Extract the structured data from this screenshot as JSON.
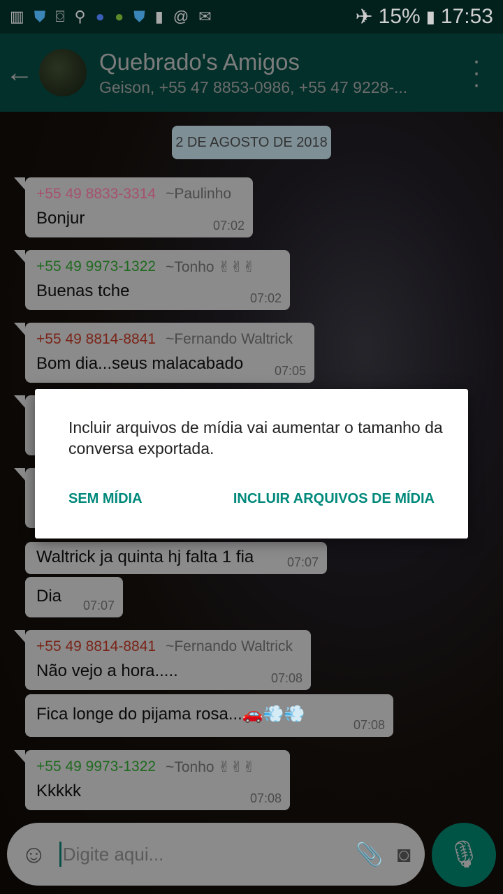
{
  "status_bar": {
    "battery": "15%",
    "time": "17:53"
  },
  "header": {
    "title": "Quebrado's Amigos",
    "subtitle": "Geison, +55 47 8853-0986, +55 47 9228-..."
  },
  "date_label": "2 DE AGOSTO DE 2018",
  "messages": [
    {
      "number": "+55 49 8833-3314",
      "alias": "~Paulinho",
      "text": "Bonjur",
      "time": "07:02"
    },
    {
      "number": "+55 49 9973-1322",
      "alias": "~Tonho ✌✌✌",
      "text": "Buenas tche",
      "time": "07:02"
    },
    {
      "number": "+55 49 8814-8841",
      "alias": "~Fernando Waltrick",
      "text": "Bom dia...seus malacabado",
      "time": "07:05"
    },
    {
      "text": "Waltrick ja quinta hj falta 1 fia",
      "time": "07:07"
    },
    {
      "text": "Dia",
      "time": "07:07"
    },
    {
      "number": "+55 49 8814-8841",
      "alias": "~Fernando Waltrick",
      "text": "Não vejo a hora.....",
      "time": "07:08"
    },
    {
      "text": "Fica longe do pijama rosa...🚗💨💨",
      "time": "07:08"
    },
    {
      "number": "+55 49 9973-1322",
      "alias": "~Tonho ✌✌✌",
      "text": "Kkkkk",
      "time": "07:08"
    }
  ],
  "input": {
    "placeholder": "Digite aqui..."
  },
  "dialog": {
    "message": "Incluir arquivos de mídia vai aumentar o tamanho da conversa exportada.",
    "no_media": "SEM MÍDIA",
    "include_media": "INCLUIR ARQUIVOS DE MÍDIA"
  },
  "colors": {
    "pink": "#e0679b",
    "green": "#2e9e2e",
    "brown": "#c0392b",
    "accent": "#00897b"
  }
}
